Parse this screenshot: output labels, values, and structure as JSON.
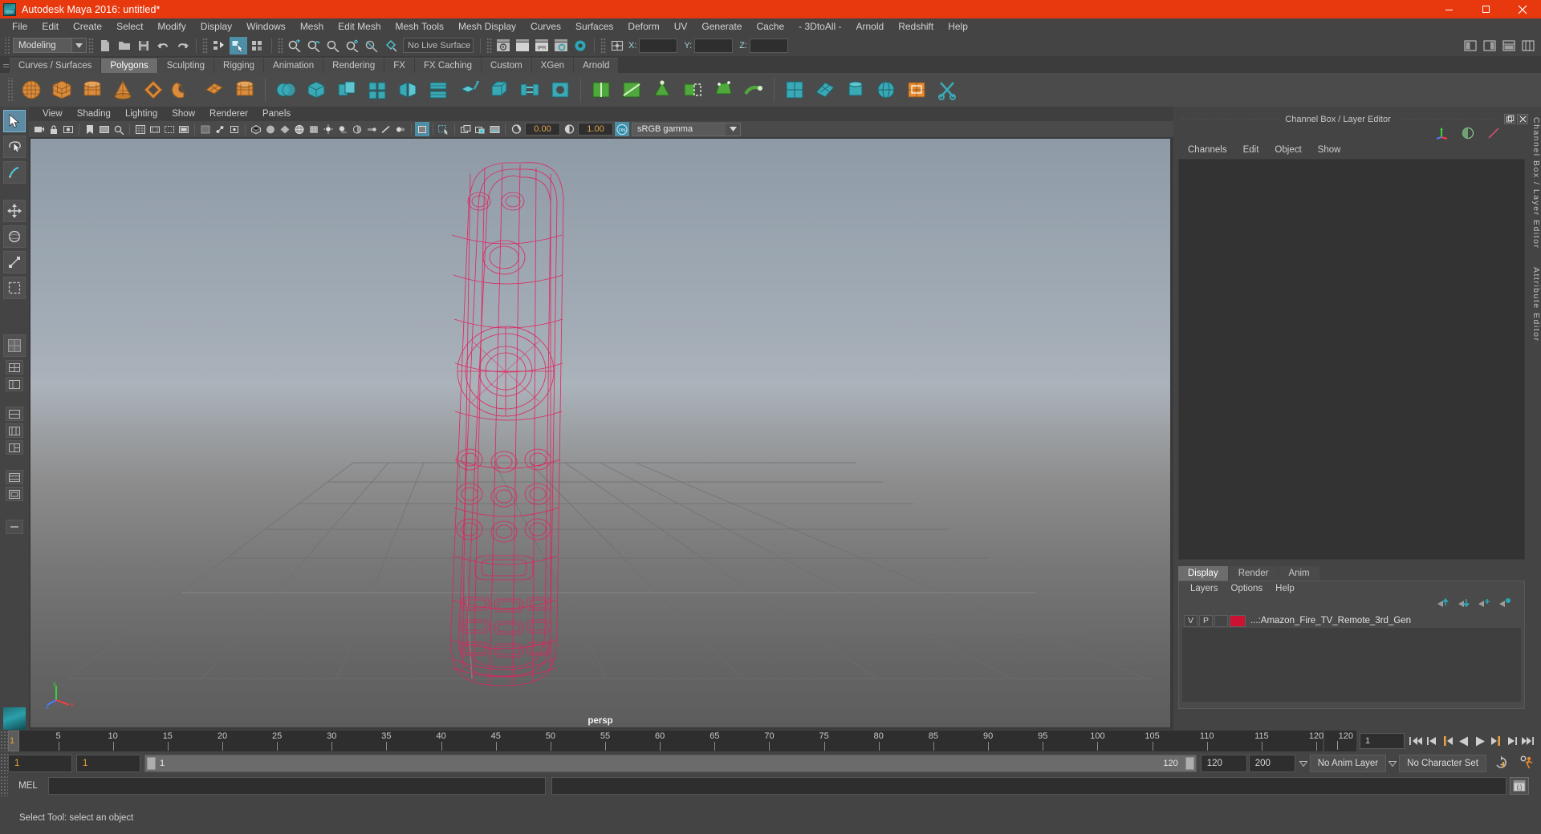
{
  "window": {
    "title": "Autodesk Maya 2016: untitled*",
    "logo_icon": "maya-logo-icon",
    "minimize_label": "Minimize",
    "maximize_label": "Restore",
    "close_label": "Close",
    "titlebar_color": "#e8380d"
  },
  "menubar": {
    "items": [
      "File",
      "Edit",
      "Create",
      "Select",
      "Modify",
      "Display",
      "Windows",
      "Mesh",
      "Edit Mesh",
      "Mesh Tools",
      "Mesh Display",
      "Curves",
      "Surfaces",
      "Deform",
      "UV",
      "Generate",
      "Cache",
      "- 3DtoAll -",
      "Arnold",
      "Redshift",
      "Help"
    ]
  },
  "statusline": {
    "mode": "Modeling",
    "live_surface": "No Live Surface",
    "coord_x_label": "X:",
    "coord_y_label": "Y:",
    "coord_z_label": "Z:",
    "coord_x_value": "",
    "coord_y_value": "",
    "coord_z_value": "",
    "icons": [
      "new-scene-icon",
      "open-scene-icon",
      "save-scene-icon",
      "undo-icon",
      "redo-icon",
      "select-hierarchy-icon",
      "select-object-icon",
      "select-component-icon",
      "snap-grid-icon",
      "snap-curve-icon",
      "snap-point-icon",
      "snap-projected-icon",
      "snap-view-plane-icon",
      "make-live-icon",
      "render-view-icon",
      "render-current-frame-icon",
      "ipr-render-icon",
      "render-settings-icon",
      "hypershade-icon",
      "input-output-connections-icon"
    ],
    "right_icons": [
      "show-hide-channel-box-icon",
      "show-hide-layer-editor-icon",
      "show-hide-attribute-editor-icon",
      "show-hide-tool-settings-icon"
    ]
  },
  "shelf": {
    "tabs": [
      "Curves / Surfaces",
      "Polygons",
      "Sculpting",
      "Rigging",
      "Animation",
      "Rendering",
      "FX",
      "FX Caching",
      "Custom",
      "XGen",
      "Arnold"
    ],
    "selected_tab": "Polygons",
    "buttons": [
      "poly-sphere-icon",
      "poly-cube-icon",
      "poly-cylinder-icon",
      "poly-cone-icon",
      "poly-torus-icon",
      "poly-plane-icon",
      "poly-disc-icon",
      "poly-platonic-icon",
      "poly-pipe-icon",
      "poly-prism-icon",
      "poly-pyramid-icon",
      "combine-icon",
      "separate-icon",
      "boolean-icon",
      "smooth-icon",
      "mirror-geometry-icon",
      "extrude-icon",
      "bevel-icon",
      "bridge-icon",
      "fill-hole-icon",
      "insert-edge-loop-icon",
      "multi-cut-icon",
      "target-weld-icon",
      "append-polygon-icon",
      "sculpt-geometry-icon",
      "quad-draw-icon",
      "uv-editor-icon",
      "planar-mapping-icon",
      "cylindrical-mapping-icon",
      "spherical-mapping-icon",
      "automatic-mapping-icon",
      "uv-layout-icon",
      "uv-cut-icon"
    ]
  },
  "toolbox": {
    "tools": [
      {
        "name": "select-tool",
        "selected": true
      },
      {
        "name": "lasso-select-tool",
        "selected": false
      },
      {
        "name": "paint-select-tool",
        "selected": false
      },
      {
        "name": "move-tool",
        "selected": false
      },
      {
        "name": "rotate-tool",
        "selected": false
      },
      {
        "name": "scale-tool",
        "selected": false
      },
      {
        "name": "last-tool-used",
        "selected": false
      }
    ],
    "layouts": [
      "single-perspective-layout",
      "four-view-layout",
      "persp-outliner-layout",
      "persp-graph-layout",
      "two-pane-stacked-layout",
      "three-pane-layout",
      "hypershade-layout",
      "persp-uv-layout"
    ]
  },
  "viewport": {
    "menus": [
      "View",
      "Shading",
      "Lighting",
      "Show",
      "Renderer",
      "Panels"
    ],
    "exposure_value": "0.00",
    "gamma_value": "1.00",
    "color_management": "sRGB gamma",
    "color_management_toggle": "ON",
    "camera_label": "persp",
    "axis_labels": {
      "x": "x",
      "y": "y",
      "z": "z"
    },
    "object_wireframe_color": "#e0245e",
    "toolbar_icons": [
      "select-camera-icon",
      "lock-camera-icon",
      "camera-attributes-icon",
      "bookmark-icon",
      "image-plane-icon",
      "two-d-pan-zoom-icon",
      "grid-toggle-icon",
      "film-gate-icon",
      "resolution-gate-icon",
      "gate-mask-icon",
      "xray-toggle-icon",
      "xray-joints-icon",
      "xray-active-components-icon",
      "wireframe-shaded-icon",
      "smooth-shade-all-icon",
      "flat-shade-icon",
      "wireframe-on-shaded-icon",
      "texture-toggle-icon",
      "use-default-lighting-icon",
      "shadows-toggle-icon",
      "screen-space-ao-icon",
      "motion-blur-icon",
      "multisample-aa-icon",
      "depth-of-field-icon",
      "isolate-select-icon",
      "exposure-icon",
      "gamma-icon",
      "color-management-icon"
    ]
  },
  "channelbox": {
    "panel_title": "Channel Box / Layer Editor",
    "menus": [
      "Channels",
      "Edit",
      "Object",
      "Show"
    ],
    "header_icons": [
      "transform-channels-icon",
      "shape-channels-icon",
      "output-channels-icon"
    ],
    "float_button": "float-panel-icon",
    "close_button": "close-panel-icon"
  },
  "layereditor": {
    "tabs": [
      "Display",
      "Render",
      "Anim"
    ],
    "selected_tab": "Display",
    "menus": [
      "Layers",
      "Options",
      "Help"
    ],
    "toolbar_icons": [
      "move-layer-up-icon",
      "move-layer-down-icon",
      "new-layer-icon",
      "new-layer-from-selected-icon"
    ],
    "layers": [
      {
        "visibility": "V",
        "playback": "P",
        "extra": "",
        "color": "#cc1133",
        "name": "...:Amazon_Fire_TV_Remote_3rd_Gen"
      }
    ]
  },
  "dock": {
    "labels": [
      "Channel Box / Layer Editor",
      "Attribute Editor"
    ]
  },
  "timeslider": {
    "current_frame": "1",
    "start": 1,
    "end": 120,
    "ticks": [
      5,
      10,
      15,
      20,
      25,
      30,
      35,
      40,
      45,
      50,
      55,
      60,
      65,
      70,
      75,
      80,
      85,
      90,
      95,
      100,
      105,
      110,
      115,
      120
    ],
    "frame_field": "1",
    "end_display": "120",
    "playback_buttons": [
      "go-to-start-icon",
      "step-back-frame-icon",
      "step-back-key-icon",
      "play-backwards-icon",
      "play-forwards-icon",
      "step-forward-key-icon",
      "step-forward-frame-icon",
      "go-to-end-icon"
    ]
  },
  "rangeslider": {
    "anim_start": "1",
    "range_start": "1",
    "bar_start_label": "1",
    "bar_end_label": "120",
    "range_end": "120",
    "anim_end": "200",
    "anim_layer": "No Anim Layer",
    "character_set": "No Character Set",
    "auto_key_icon": "auto-keyframe-icon",
    "anim_prefs_icon": "animation-preferences-icon"
  },
  "commandline": {
    "label": "MEL",
    "input_value": "",
    "script_editor_icon": "script-editor-icon"
  },
  "helpline": {
    "text": "Select Tool: select an object"
  }
}
